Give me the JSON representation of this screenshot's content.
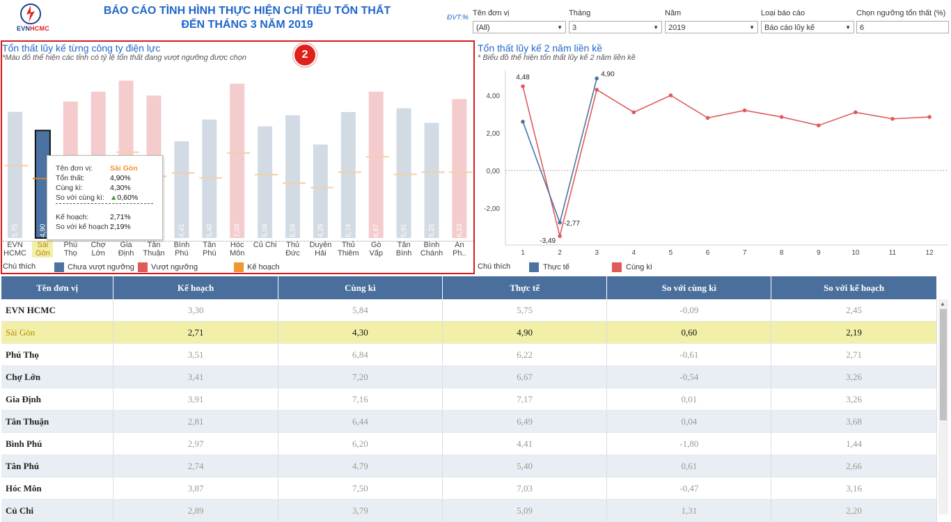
{
  "header": {
    "title_line1": "BÁO CÁO TÌNH HÌNH THỰC HIỆN CHỈ TIÊU TỔN THẤT",
    "title_line2": "ĐẾN THÁNG 3 NĂM 2019",
    "logo_text_a": "EVN",
    "logo_text_b": "HCMC",
    "unit": "ĐVT:%"
  },
  "filters": [
    {
      "label": "Tên đơn vị",
      "value": "(All)"
    },
    {
      "label": "Tháng",
      "value": "3"
    },
    {
      "label": "Năm",
      "value": "2019"
    },
    {
      "label": "Loại báo cáo",
      "value": "Báo cáo lũy kế"
    },
    {
      "label": "Chọn ngưỡng tổn thất (%)",
      "value": "6"
    }
  ],
  "bar_section": {
    "title": "Tổn thất lũy kế từng công ty điện lực",
    "subtitle": "*Màu đỏ thể hiện các tỉnh có tỷ lệ tổn thất đang vượt ngưỡng được chọn",
    "badge": "2",
    "legend_title": "Chú thích",
    "legend": [
      {
        "label": "Chưa vượt ngưỡng",
        "color": "#4a73a3"
      },
      {
        "label": "Vượt ngưỡng",
        "color": "#e0595b"
      },
      {
        "label": "Kế hoạch",
        "color": "#f0962c"
      }
    ]
  },
  "line_section": {
    "title": "Tổn thất lũy kế 2 năm liền kề",
    "subtitle": "* Biểu đồ thể hiện tổn thất lũy kế 2 năm liền kề",
    "legend_title": "Chú thích",
    "legend": [
      {
        "label": "Thực tế",
        "color": "#4a73a3"
      },
      {
        "label": "Cùng kì",
        "color": "#e0595b"
      }
    ]
  },
  "tooltip": {
    "rows": [
      {
        "k": "Tên đơn vị:",
        "v": "Sài Gòn"
      },
      {
        "k": "Tổn thất:",
        "v": "4,90%"
      },
      {
        "k": "Cùng kì:",
        "v": "4,30%"
      },
      {
        "k": "So với cùng kì:",
        "v": "▲0,60%"
      },
      {
        "k": "Kế hoạch:",
        "v": "2,71%"
      },
      {
        "k": "So với kế hoạch :",
        "v": "2,19%"
      }
    ]
  },
  "chart_data": [
    {
      "type": "bar",
      "categories": [
        "EVN HCMC",
        "Sài Gòn",
        "Phú Thọ",
        "Chợ Lớn",
        "Gia Định",
        "Tân Thuận",
        "Bình Phú",
        "Tân Phú",
        "Hóc Môn",
        "Củ Chi",
        "Thủ Đức",
        "Duyên Hải",
        "Thủ Thiêm",
        "Gò Vấp",
        "Tân Bình",
        "Bình Chánh",
        "An Ph.."
      ],
      "categories_display": [
        [
          "EVN",
          "HCMC"
        ],
        [
          "Sài",
          "Gòn"
        ],
        [
          "Phú",
          "Thọ"
        ],
        [
          "Chợ",
          "Lớn"
        ],
        [
          "Gia",
          "Định"
        ],
        [
          "Tân",
          "Thuận"
        ],
        [
          "Bình",
          "Phú"
        ],
        [
          "Tân",
          "Phú"
        ],
        [
          "Hóc",
          "Môn"
        ],
        [
          "Củ Chi",
          ""
        ],
        [
          "Thủ",
          "Đức"
        ],
        [
          "Duyên",
          "Hải"
        ],
        [
          "Thủ",
          "Thiêm"
        ],
        [
          "Gò",
          "Vấp"
        ],
        [
          "Tân",
          "Bình"
        ],
        [
          "Bình",
          "Chánh"
        ],
        [
          "An",
          "Ph.."
        ]
      ],
      "values": [
        5.75,
        4.9,
        6.22,
        6.67,
        7.17,
        6.49,
        4.41,
        5.4,
        7.03,
        5.09,
        5.59,
        4.26,
        5.74,
        6.67,
        5.91,
        5.25,
        6.33
      ],
      "labels": [
        "5,75",
        "4,90",
        "",
        "",
        "",
        "",
        "4,41",
        "5,40",
        "7,03",
        "5,09",
        "5,59",
        "4,26",
        "5,74",
        "6,67",
        "5,91",
        "5,25",
        "6,33"
      ],
      "plan": [
        3.3,
        2.71,
        3.51,
        3.41,
        3.91,
        2.81,
        2.97,
        2.74,
        3.87,
        2.89,
        2.5,
        2.3,
        3.0,
        3.7,
        2.9,
        3.0,
        3.0
      ],
      "threshold": 6,
      "selected": "Sài Gòn",
      "ylim": [
        0,
        7.8
      ],
      "colors": {
        "below": "#4a73a3",
        "above": "#e0595b",
        "plan": "#f0962c"
      }
    },
    {
      "type": "line",
      "x": [
        1,
        2,
        3,
        4,
        5,
        6,
        7,
        8,
        9,
        10,
        11,
        12
      ],
      "series": [
        {
          "name": "Thực tế",
          "color": "#4a73a3",
          "values": [
            2.6,
            -2.77,
            4.9
          ]
        },
        {
          "name": "Cùng kì",
          "color": "#e0595b",
          "values": [
            4.48,
            -3.49,
            4.3,
            3.1,
            4.0,
            2.8,
            3.2,
            2.85,
            2.4,
            3.1,
            2.75,
            2.85
          ]
        }
      ],
      "point_labels": [
        {
          "series": 1,
          "index": 0,
          "text": "4,48"
        },
        {
          "series": 1,
          "index": 1,
          "text": "-3,49"
        },
        {
          "series": 0,
          "index": 1,
          "text": "-2,77"
        },
        {
          "series": 0,
          "index": 2,
          "text": "4,90"
        }
      ],
      "yticks": [
        4,
        2,
        0,
        -2
      ],
      "ytick_labels": [
        "4,00",
        "2,00",
        "0,00",
        "-2,00"
      ],
      "ylim": [
        -3.8,
        5.2
      ],
      "grid": false
    }
  ],
  "table": {
    "columns": [
      "Tên đơn vị",
      "Kế hoạch",
      "Cùng kì",
      "Thực tế",
      "So với cùng kì",
      "So với kế hoạch"
    ],
    "rows": [
      [
        "EVN HCMC",
        "3,30",
        "5,84",
        "5,75",
        "-0,09",
        "2,45"
      ],
      [
        "Sài Gòn",
        "2,71",
        "4,30",
        "4,90",
        "0,60",
        "2,19"
      ],
      [
        "Phú Thọ",
        "3,51",
        "6,84",
        "6,22",
        "-0,61",
        "2,71"
      ],
      [
        "Chợ Lớn",
        "3,41",
        "7,20",
        "6,67",
        "-0,54",
        "3,26"
      ],
      [
        "Gia Định",
        "3,91",
        "7,16",
        "7,17",
        "0,01",
        "3,26"
      ],
      [
        "Tân Thuận",
        "2,81",
        "6,44",
        "6,49",
        "0,04",
        "3,68"
      ],
      [
        "Bình Phú",
        "2,97",
        "6,20",
        "4,41",
        "-1,80",
        "1,44"
      ],
      [
        "Tân Phú",
        "2,74",
        "4,79",
        "5,40",
        "0,61",
        "2,66"
      ],
      [
        "Hóc Môn",
        "3,87",
        "7,50",
        "7,03",
        "-0,47",
        "3,16"
      ],
      [
        "Củ Chi",
        "2,89",
        "3,79",
        "5,09",
        "1,31",
        "2,20"
      ]
    ],
    "selected_index": 1
  }
}
